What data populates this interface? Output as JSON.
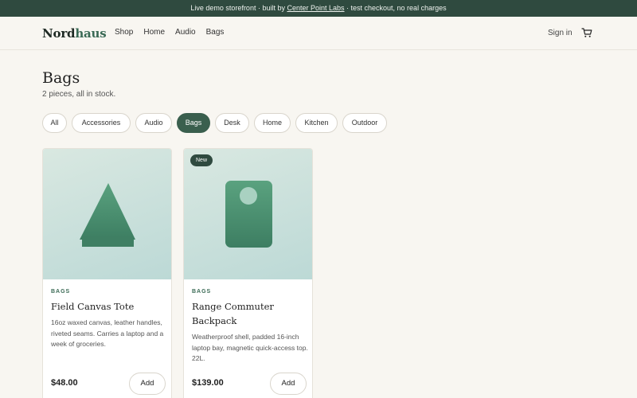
{
  "banner": {
    "prefix": "Live demo storefront · built by ",
    "link": "Center Point Labs",
    "suffix": " · test checkout, no real charges"
  },
  "header": {
    "logo_main": "Nord",
    "logo_alt": "haus",
    "nav": [
      "Shop",
      "Home",
      "Audio",
      "Bags"
    ],
    "signin": "Sign in",
    "cart_icon": "cart-icon"
  },
  "main": {
    "title": "Bags",
    "subtitle": "2 pieces, all in stock.",
    "filters": [
      "All",
      "Accessories",
      "Audio",
      "Bags",
      "Desk",
      "Home",
      "Kitchen",
      "Outdoor"
    ],
    "active_filter": "Bags",
    "products": [
      {
        "badge": "",
        "category": "BAGS",
        "name": "Field Canvas Tote",
        "description": "16oz waxed canvas, leather handles, riveted seams. Carries a laptop and a week of groceries.",
        "price": "$48.00",
        "add_label": "Add",
        "icon": "tote-icon"
      },
      {
        "badge": "New",
        "category": "BAGS",
        "name": "Range Commuter Backpack",
        "description": "Weatherproof shell, padded 16-inch laptop bay, magnetic quick-access top. 22L.",
        "price": "$139.00",
        "add_label": "Add",
        "icon": "backpack-icon"
      }
    ]
  },
  "colors": {
    "accent": "#3a5f4e",
    "banner": "#2f4a3f",
    "background": "#f8f6f1"
  }
}
